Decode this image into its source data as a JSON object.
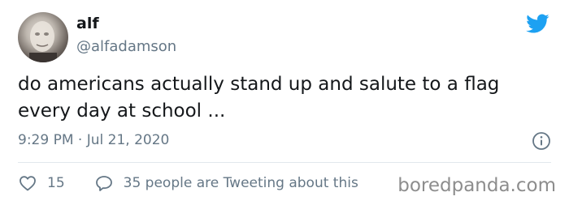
{
  "user": {
    "name": "alf",
    "handle": "@alfadamson"
  },
  "tweet": {
    "text": "do americans actually stand up and salute to a flag every day at school ...",
    "timestamp": "9:29 PM · Jul 21, 2020"
  },
  "actions": {
    "like_count": "15",
    "retweet_text": "35 people are Tweeting about this"
  },
  "watermark": "boredpanda.com",
  "colors": {
    "twitter_blue": "#1da1f2",
    "text_primary": "#14171a",
    "text_secondary": "#657786"
  },
  "icons": {
    "logo": "twitter-bird-icon",
    "info": "info-icon",
    "like": "heart-icon",
    "reply": "speech-bubble-icon"
  }
}
